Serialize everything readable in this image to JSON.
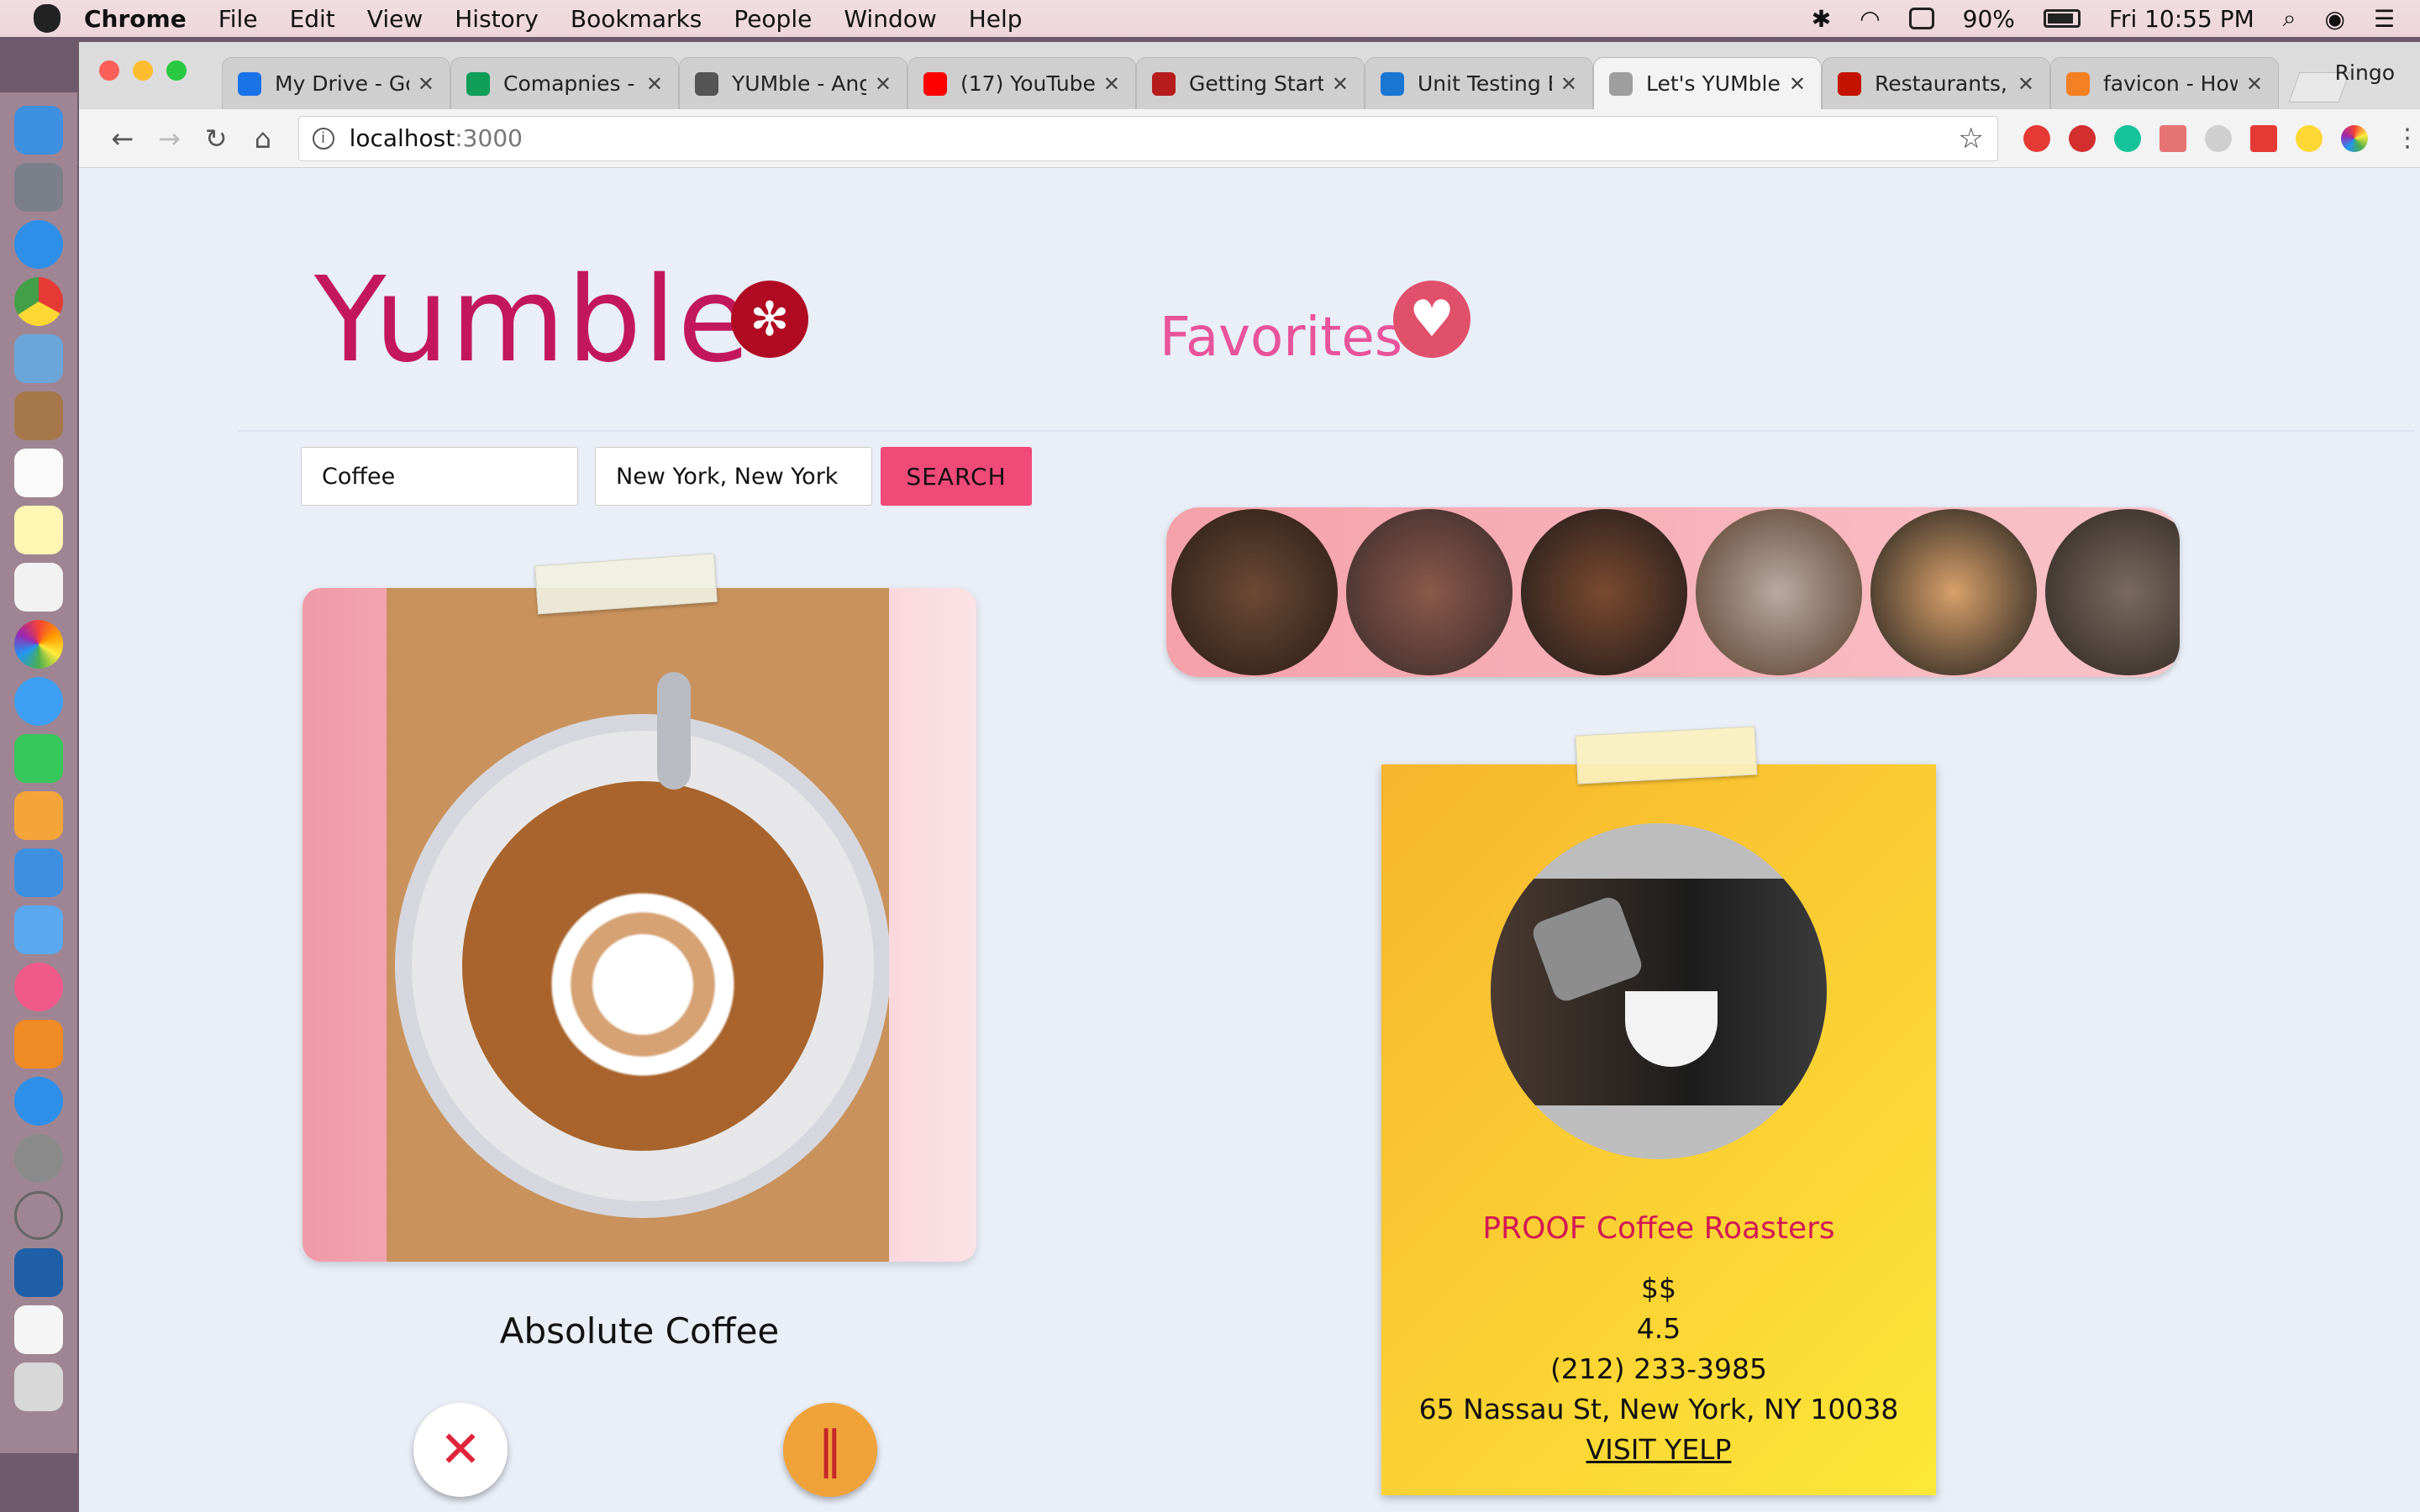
{
  "menubar": {
    "app": "Chrome",
    "items": [
      "File",
      "Edit",
      "View",
      "History",
      "Bookmarks",
      "People",
      "Window",
      "Help"
    ],
    "battery": "90%",
    "clock": "Fri 10:55 PM"
  },
  "tabs": [
    {
      "label": "My Drive - Goo",
      "icon_color": "#1a73e8"
    },
    {
      "label": "Comapnies - G",
      "icon_color": "#0f9d58"
    },
    {
      "label": "YUMble - Ang",
      "icon_color": "#555555"
    },
    {
      "label": "(17) YouTube",
      "icon_color": "#ff0000"
    },
    {
      "label": "Getting Starte",
      "icon_color": "#b71c1c"
    },
    {
      "label": "Unit Testing E",
      "icon_color": "#1976d2"
    },
    {
      "label": "Let's YUMble!",
      "icon_color": "#9e9e9e"
    },
    {
      "label": "Restaurants, D",
      "icon_color": "#c41200"
    },
    {
      "label": "favicon - How",
      "icon_color": "#f48024"
    }
  ],
  "profile": "Ringo",
  "address": {
    "host": "localhost",
    "port": ":3000"
  },
  "app": {
    "logo": "Yumble",
    "favorites_label": "Favorites",
    "search_term": "Coffee",
    "location": "New York, New York",
    "search_button": "SEARCH"
  },
  "current": {
    "name": "Absolute Coffee"
  },
  "favorite_detail": {
    "name": "PROOF Coffee Roasters",
    "price": "$$",
    "rating": "4.5",
    "phone": "(212) 233-3985",
    "address": "65 Nassau St, New York, NY 10038",
    "link": "VISIT YELP"
  },
  "colors": {
    "brand": "#c2185b",
    "accent": "#f04a79",
    "favorite": "#e8539a"
  }
}
